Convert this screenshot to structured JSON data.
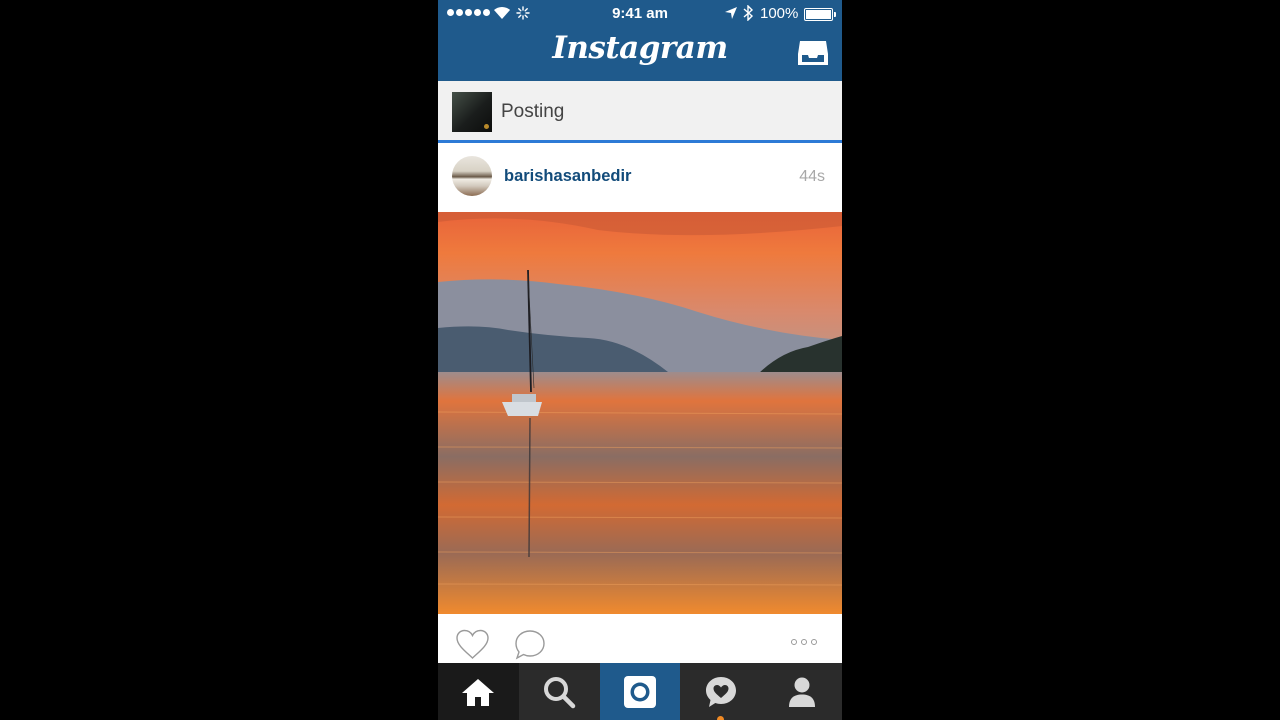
{
  "status_bar": {
    "time": "9:41 am",
    "battery_text": "100%",
    "battery_level": 1.0
  },
  "header": {
    "logo_text": "Instagram",
    "inbox_icon": "inbox-icon"
  },
  "posting": {
    "label": "Posting",
    "progress": 1.0
  },
  "post": {
    "username": "barishasanbedir",
    "time_ago": "44s"
  },
  "actions": {
    "like_icon": "heart-icon",
    "comment_icon": "comment-icon",
    "more_icon": "more-icon"
  },
  "tabbar": {
    "tabs": [
      "home-icon",
      "search-icon",
      "camera-icon",
      "activity-icon",
      "profile-icon"
    ],
    "active": "home-icon"
  },
  "colors": {
    "brand_blue": "#1f5a8c",
    "username_blue": "#124b7a",
    "progress_blue": "#2d7ad6",
    "notification_orange": "#f08a24"
  }
}
